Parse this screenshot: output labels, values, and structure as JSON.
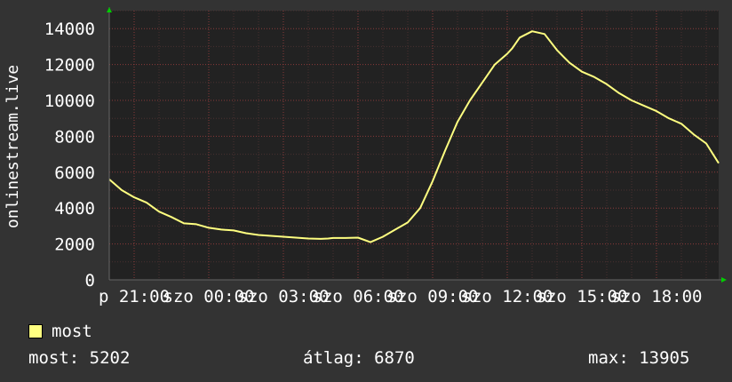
{
  "chart_data": {
    "type": "line",
    "ylabel": "onlinestream.live",
    "ylim": [
      0,
      15000
    ],
    "y_ticks": [
      0,
      2000,
      4000,
      6000,
      8000,
      10000,
      12000,
      14000
    ],
    "x_tick_labels": [
      "p 21:00",
      "szo 00:00",
      "szo 03:00",
      "szo 06:00",
      "szo 09:00",
      "szo 12:00",
      "szo 15:00",
      "szo 18:00"
    ],
    "grid": true,
    "series": [
      {
        "name": "most",
        "color": "#ffff80",
        "x": [
          0,
          0.5,
          1,
          1.5,
          2,
          2.5,
          3,
          3.5,
          4,
          4.5,
          5,
          5.5,
          6,
          6.5,
          7,
          7.5,
          8,
          8.5,
          8.8,
          9,
          9.5,
          10,
          10.5,
          11,
          11.5,
          12,
          12.5,
          13,
          13.5,
          14,
          14.5,
          15,
          15.5,
          16,
          16.2,
          16.5,
          17,
          17.5,
          18,
          18.5,
          19,
          19.5,
          20,
          20.5,
          21,
          21.5,
          22,
          22.5,
          23,
          23.5,
          24,
          24.5
        ],
        "values": [
          5600,
          5000,
          4600,
          4300,
          3800,
          3500,
          3150,
          3100,
          2900,
          2800,
          2750,
          2600,
          2500,
          2450,
          2400,
          2350,
          2300,
          2280,
          2300,
          2330,
          2330,
          2350,
          2100,
          2400,
          2800,
          3200,
          4000,
          5500,
          7200,
          8800,
          10000,
          11000,
          12000,
          12600,
          12900,
          13500,
          13850,
          13700,
          12800,
          12100,
          11600,
          11300,
          10900,
          10400,
          10000,
          9700,
          9400,
          9000,
          8700,
          8100,
          7600,
          6500
        ]
      }
    ]
  },
  "legend": {
    "label": "most",
    "color": "#ffff80"
  },
  "stats": {
    "current": "most: 5202",
    "average": "átlag: 6870",
    "max": "max: 13905"
  }
}
